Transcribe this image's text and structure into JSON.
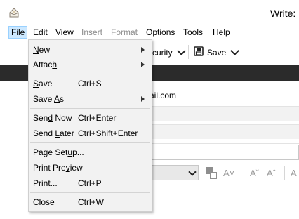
{
  "window": {
    "title": "Write:"
  },
  "menubar": {
    "items": [
      {
        "label": "File",
        "u": "F",
        "rest": "ile",
        "state": "active"
      },
      {
        "label": "Edit",
        "u": "E",
        "rest": "dit",
        "state": "normal"
      },
      {
        "label": "View",
        "u": "V",
        "rest": "iew",
        "state": "normal"
      },
      {
        "label": "Insert",
        "u": "",
        "rest": "Insert",
        "state": "disabled"
      },
      {
        "label": "Format",
        "u": "",
        "rest": "Format",
        "state": "disabled"
      },
      {
        "label": "Options",
        "u": "O",
        "rest": "ptions",
        "state": "normal"
      },
      {
        "label": "Tools",
        "u": "T",
        "rest": "ools",
        "state": "normal"
      },
      {
        "label": "Help",
        "u": "H",
        "rest": "elp",
        "state": "normal"
      }
    ]
  },
  "toolbar": {
    "security_label": "curity",
    "save_label": "Save"
  },
  "header": {
    "from_value": "ail.com"
  },
  "file_menu": {
    "new": {
      "pre": "",
      "u": "N",
      "post": "ew",
      "shortcut": ""
    },
    "attach": {
      "pre": "Attac",
      "u": "h",
      "post": "",
      "shortcut": ""
    },
    "save": {
      "pre": "",
      "u": "S",
      "post": "ave",
      "shortcut": "Ctrl+S"
    },
    "save_as": {
      "pre": "Save ",
      "u": "A",
      "post": "s",
      "shortcut": ""
    },
    "send_now": {
      "pre": "Sen",
      "u": "d",
      "post": " Now",
      "shortcut": "Ctrl+Enter"
    },
    "send_later": {
      "pre": "Send ",
      "u": "L",
      "post": "ater",
      "shortcut": "Ctrl+Shift+Enter"
    },
    "page_setup": {
      "pre": "Page Set",
      "u": "u",
      "post": "p...",
      "shortcut": ""
    },
    "print_preview": {
      "pre": "Print Pre",
      "u": "v",
      "post": "iew",
      "shortcut": ""
    },
    "print": {
      "pre": "",
      "u": "P",
      "post": "rint...",
      "shortcut": "Ctrl+P"
    },
    "close": {
      "pre": "",
      "u": "C",
      "post": "lose",
      "shortcut": "Ctrl+W"
    }
  }
}
